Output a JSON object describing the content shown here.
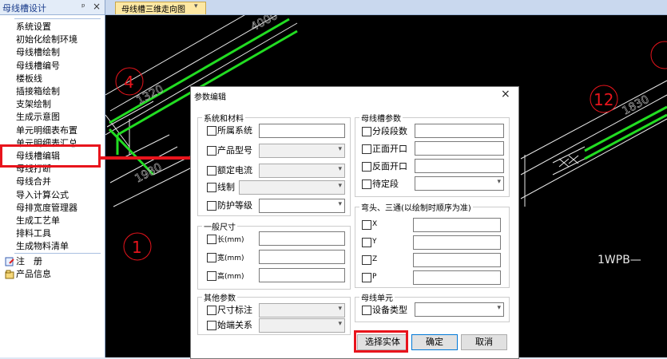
{
  "panel": {
    "title": "母线槽设计",
    "pin": "ᵖ",
    "close": "×",
    "items": [
      "系统设置",
      "初始化绘制环境",
      "母线槽绘制",
      "母线槽编号",
      "楼板线",
      "插接箱绘制",
      "支架绘制",
      "生成示意图",
      "单元明细表布置",
      "单元明细表汇总",
      "母线槽编辑",
      "母线打断",
      "母线合并",
      "导入计算公式",
      "母排宽度管理器",
      "生成工艺单",
      "排料工具",
      "生成物料清单"
    ],
    "register": "注　册",
    "product_info": "产品信息"
  },
  "tab": {
    "label": "母线槽三维走向图"
  },
  "canvas": {
    "circle_labels": [
      "4",
      "1",
      "12"
    ],
    "dims": [
      "4000",
      "1320",
      "1830",
      "1980"
    ],
    "text_1wpb": "1WPB—"
  },
  "dialog": {
    "title": "参数编辑",
    "close": "×",
    "sys": {
      "title": "系统和材料",
      "rows": [
        "所属系统",
        "产品型号",
        "额定电流",
        "线制",
        "防护等级"
      ]
    },
    "gen": {
      "title": "一般尺寸",
      "rows": [
        "长(mm)",
        "宽(mm)",
        "高(mm)"
      ]
    },
    "other": {
      "title": "其他参数",
      "rows": [
        "尺寸标注",
        "始端关系"
      ]
    },
    "bus": {
      "title": "母线槽参数",
      "rows": [
        "分段段数",
        "正面开口",
        "反面开口",
        "待定段"
      ]
    },
    "elbow": {
      "title": "弯头、三通(以绘制时顺序为准)",
      "rows": [
        "X",
        "Y",
        "Z",
        "P"
      ]
    },
    "unit": {
      "title": "母线单元",
      "rows": [
        "设备类型"
      ]
    },
    "buttons": {
      "select": "选择实体",
      "ok": "确定",
      "cancel": "取消"
    }
  },
  "colors": {
    "accent_red": "#e8141c",
    "bus_green": "#22dd22",
    "line_white": "#e8e8e8"
  }
}
